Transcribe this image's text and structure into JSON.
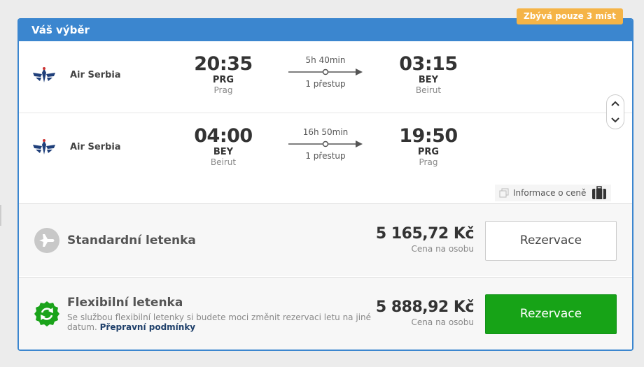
{
  "header": {
    "title": "Váš výběr"
  },
  "badge": {
    "text": "Zbývá pouze 3 míst"
  },
  "flights": [
    {
      "airline": "Air Serbia",
      "departure": {
        "time": "20:35",
        "code": "PRG",
        "city": "Prag"
      },
      "duration": "5h 40min",
      "stops": "1 přestup",
      "arrival": {
        "time": "03:15",
        "code": "BEY",
        "city": "Beirut"
      }
    },
    {
      "airline": "Air Serbia",
      "departure": {
        "time": "04:00",
        "code": "BEY",
        "city": "Beirut"
      },
      "duration": "16h 50min",
      "stops": "1 přestup",
      "arrival": {
        "time": "19:50",
        "code": "PRG",
        "city": "Prag"
      }
    }
  ],
  "price_info": {
    "label": "Informace o ceně"
  },
  "fares": {
    "standard": {
      "title": "Standardní letenka",
      "price": "5 165,72 Kč",
      "per_person": "Cena na osobu",
      "button": "Rezervace"
    },
    "flexible": {
      "title": "Flexibilní letenka",
      "description": "Se službou flexibilní letenky si budete moci změnit rezervaci letu na jiné datum.",
      "link": "Přepravní podmínky",
      "price": "5 888,92 Kč",
      "per_person": "Cena na osobu",
      "button": "Rezervace"
    }
  },
  "icons": {
    "airline_logo": "air-serbia-eagle-icon",
    "plane": "plane-icon",
    "flexible": "refresh-icon",
    "scroll_up": "chevron-up-icon",
    "scroll_down": "chevron-down-icon",
    "copy": "copy-icon",
    "luggage": "luggage-icon"
  },
  "colors": {
    "header": "#3b86cf",
    "badge": "#f5b447",
    "green_button": "#17a317",
    "link": "#1e3f6a"
  }
}
